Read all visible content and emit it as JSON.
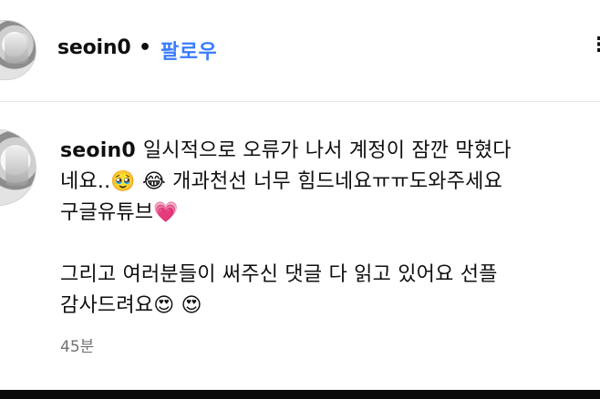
{
  "post_header": {
    "username": "seoin0",
    "separator": "•",
    "follow_label": "팔로우",
    "more_label": "⋮"
  },
  "comment": {
    "username": "seoin0",
    "lines": [
      "일시적으로 오류가 나서 계정이 잠깐 막혔다",
      "네요..🥹 😂  개과천선 너무 힘드네요ㅠㅠ도와주세요",
      "구글유튜브💗",
      "그리고 여러분들이 써주신 댓글 다 읽고 있어요 선플",
      "감사드려요😍 😍"
    ],
    "timestamp": "45분"
  }
}
